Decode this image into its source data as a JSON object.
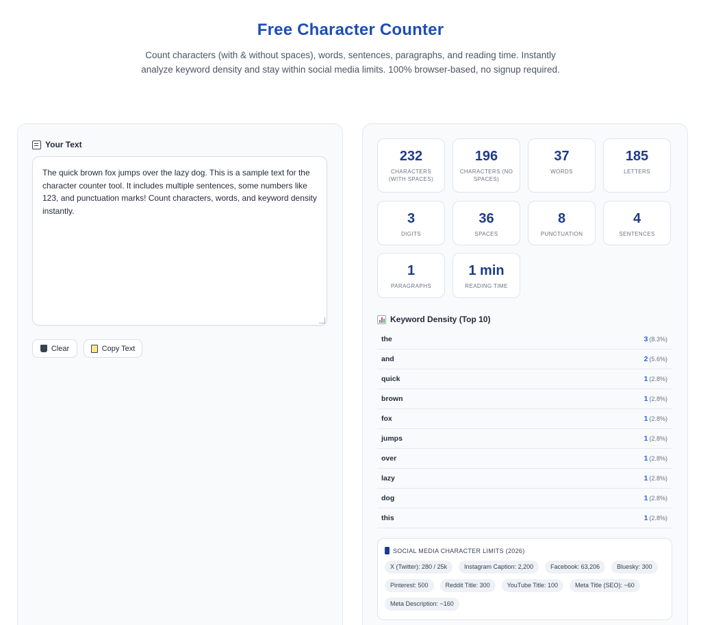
{
  "header": {
    "title": "Free Character Counter",
    "description": "Count characters (with & without spaces), words, sentences, paragraphs, and reading time. Instantly analyze keyword density and stay within social media limits. 100% browser-based, no signup required."
  },
  "editor": {
    "section_title": "Your Text",
    "text": "The quick brown fox jumps over the lazy dog. This is a sample text for the character counter tool. It includes multiple sentences, some numbers like 123, and punctuation marks! Count characters, words, and keyword density instantly.",
    "clear_label": "Clear",
    "copy_label": "Copy Text"
  },
  "stats": [
    {
      "value": "232",
      "label": "Characters (with spaces)"
    },
    {
      "value": "196",
      "label": "Characters (no spaces)"
    },
    {
      "value": "37",
      "label": "Words"
    },
    {
      "value": "185",
      "label": "Letters"
    },
    {
      "value": "3",
      "label": "Digits"
    },
    {
      "value": "36",
      "label": "Spaces"
    },
    {
      "value": "8",
      "label": "Punctuation"
    },
    {
      "value": "4",
      "label": "Sentences"
    },
    {
      "value": "1",
      "label": "Paragraphs"
    },
    {
      "value": "1 min",
      "label": "Reading Time"
    }
  ],
  "keywords": {
    "title": "Keyword Density (Top 10)",
    "rows": [
      {
        "word": "the",
        "count": "3",
        "pct": "(8.3%)"
      },
      {
        "word": "and",
        "count": "2",
        "pct": "(5.6%)"
      },
      {
        "word": "quick",
        "count": "1",
        "pct": "(2.8%)"
      },
      {
        "word": "brown",
        "count": "1",
        "pct": "(2.8%)"
      },
      {
        "word": "fox",
        "count": "1",
        "pct": "(2.8%)"
      },
      {
        "word": "jumps",
        "count": "1",
        "pct": "(2.8%)"
      },
      {
        "word": "over",
        "count": "1",
        "pct": "(2.8%)"
      },
      {
        "word": "lazy",
        "count": "1",
        "pct": "(2.8%)"
      },
      {
        "word": "dog",
        "count": "1",
        "pct": "(2.8%)"
      },
      {
        "word": "this",
        "count": "1",
        "pct": "(2.8%)"
      }
    ]
  },
  "social": {
    "title": "SOCIAL MEDIA CHARACTER LIMITS (2026)",
    "chips": [
      "X (Twitter): 280 / 25k",
      "Instagram Caption: 2,200",
      "Facebook: 63,206",
      "Bluesky: 300",
      "Pinterest: 500",
      "Reddit Title: 300",
      "YouTube Title: 100",
      "Meta Title (SEO): ~60",
      "Meta Description: ~160"
    ]
  },
  "icons": {
    "section_title": "memo-icon",
    "keywords": "bar-chart-icon",
    "social": "mobile-phone-icon",
    "clear": "trash-icon",
    "copy": "clipboard-icon"
  }
}
